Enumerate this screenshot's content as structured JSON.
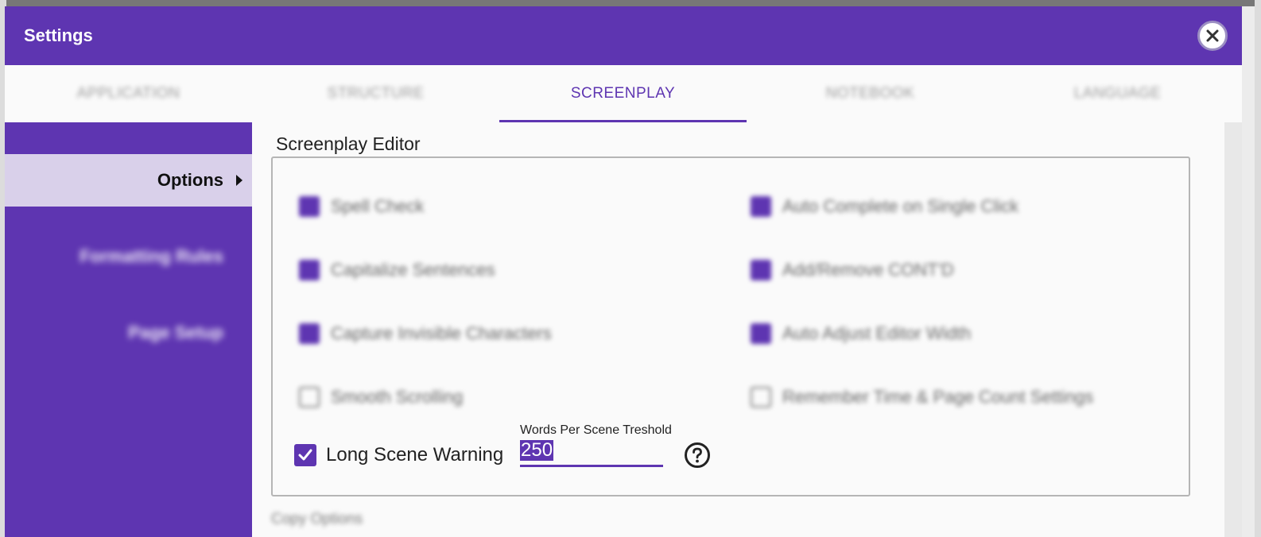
{
  "dialog": {
    "title": "Settings",
    "close_icon": "close-icon"
  },
  "tabs": [
    {
      "label": "APPLICATION",
      "active": false
    },
    {
      "label": "STRUCTURE",
      "active": false
    },
    {
      "label": "SCREENPLAY",
      "active": true
    },
    {
      "label": "NOTEBOOK",
      "active": false
    },
    {
      "label": "LANGUAGE",
      "active": false
    }
  ],
  "sidebar": {
    "items": [
      {
        "label": "Options",
        "active": true
      },
      {
        "label": "Formatting Rules",
        "active": false
      },
      {
        "label": "Page Setup",
        "active": false
      }
    ]
  },
  "editor_section": {
    "title": "Screenplay Editor",
    "options_left": [
      {
        "label": "Spell Check",
        "checked": true
      },
      {
        "label": "Capitalize Sentences",
        "checked": true
      },
      {
        "label": "Capture Invisible Characters",
        "checked": true
      },
      {
        "label": "Smooth Scrolling",
        "checked": false
      }
    ],
    "options_right": [
      {
        "label": "Auto Complete on Single Click",
        "checked": true
      },
      {
        "label": "Add/Remove CONT'D",
        "checked": true
      },
      {
        "label": "Auto Adjust Editor Width",
        "checked": true
      },
      {
        "label": "Remember Time & Page Count Settings",
        "checked": false
      }
    ],
    "long_scene_warning": {
      "label": "Long Scene Warning",
      "checked": true
    },
    "words_threshold": {
      "label": "Words Per Scene Treshold",
      "value": "250"
    },
    "help_icon": "help-circle-icon"
  },
  "next_section": {
    "title": "Copy Options"
  },
  "colors": {
    "accent": "#5e35b1",
    "sidebar_active": "#d9d0ea"
  }
}
